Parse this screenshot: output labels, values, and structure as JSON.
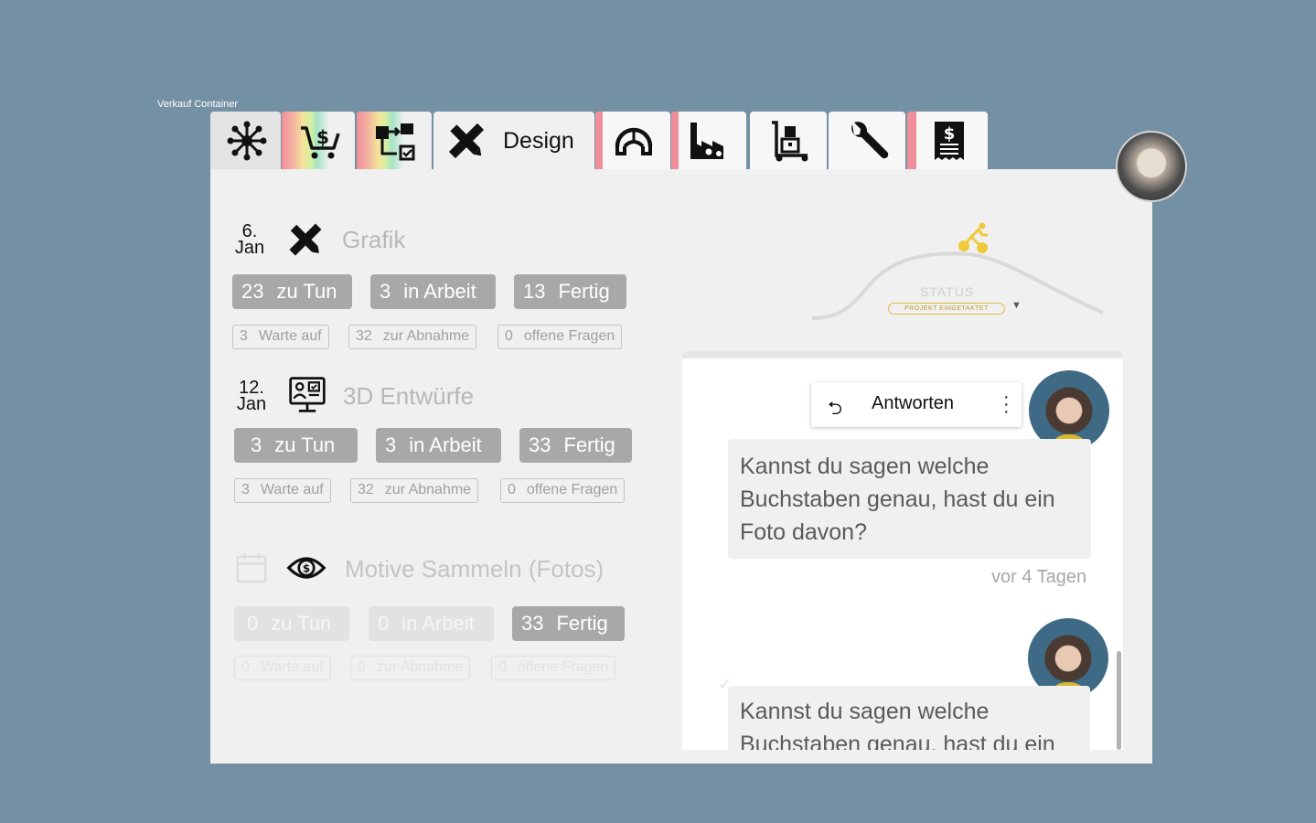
{
  "frame_label": "Verkauf Container",
  "tabs": [
    {
      "name": "hub",
      "icon": "network-hub-icon"
    },
    {
      "name": "sales",
      "icon": "cart-dollar-icon"
    },
    {
      "name": "workflow",
      "icon": "workflow-icon"
    },
    {
      "name": "design",
      "icon": "pencil-ruler-icon",
      "label": "Design"
    },
    {
      "name": "helmet",
      "icon": "helmet-icon"
    },
    {
      "name": "factory",
      "icon": "factory-icon"
    },
    {
      "name": "logistics",
      "icon": "hand-truck-icon"
    },
    {
      "name": "service",
      "icon": "wrench-icon"
    },
    {
      "name": "invoice",
      "icon": "invoice-dollar-icon"
    }
  ],
  "groups": [
    {
      "date_day": "6.",
      "date_month": "Jan",
      "icon": "pencil-ruler-icon",
      "title": "Grafik",
      "primary": [
        {
          "n": "23",
          "label": "zu Tun"
        },
        {
          "n": "3",
          "label": "in Arbeit"
        },
        {
          "n": "13",
          "label": "Fertig"
        }
      ],
      "secondary": [
        {
          "n": "3",
          "label": "Warte auf"
        },
        {
          "n": "32",
          "label": "zur Abnahme"
        },
        {
          "n": "0",
          "label": "offene Fragen"
        }
      ]
    },
    {
      "date_day": "12.",
      "date_month": "Jan",
      "icon": "3d-design-screen-icon",
      "title": "3D Entwürfe",
      "primary": [
        {
          "n": "3",
          "label": "zu Tun"
        },
        {
          "n": "3",
          "label": "in Arbeit"
        },
        {
          "n": "33",
          "label": "Fertig"
        }
      ],
      "secondary": [
        {
          "n": "3",
          "label": "Warte auf"
        },
        {
          "n": "32",
          "label": "zur Abnahme"
        },
        {
          "n": "0",
          "label": "offene Fragen"
        }
      ]
    },
    {
      "date_day": "",
      "date_month": "",
      "icon": "eye-dollar-icon",
      "title": "Motive Sammeln (Fotos)",
      "primary": [
        {
          "n": "0",
          "label": "zu Tun"
        },
        {
          "n": "0",
          "label": "in Arbeit"
        },
        {
          "n": "33",
          "label": "Fertig"
        }
      ],
      "secondary": [
        {
          "n": "0",
          "label": "Warte auf"
        },
        {
          "n": "0",
          "label": "zur Abnahme"
        },
        {
          "n": "0",
          "label": "offene Fragen"
        }
      ]
    }
  ],
  "status": {
    "label": "STATUS",
    "badge": "PROJEKT EINGETAKTET",
    "accent": "#f0c93a"
  },
  "chat": {
    "reply_label": "Antworten",
    "message_1": "Kannst du sagen welche Buchstaben genau, hast du ein Foto davon?",
    "message_1_time": "vor 4 Tagen",
    "message_2": "Kannst du sagen welche Buchstaben genau, hast du ein"
  },
  "colors": {
    "background": "#7490a4",
    "panel": "#f0f0f0",
    "pill": "#a8a8a8",
    "tab_marker": "#f08f99"
  }
}
